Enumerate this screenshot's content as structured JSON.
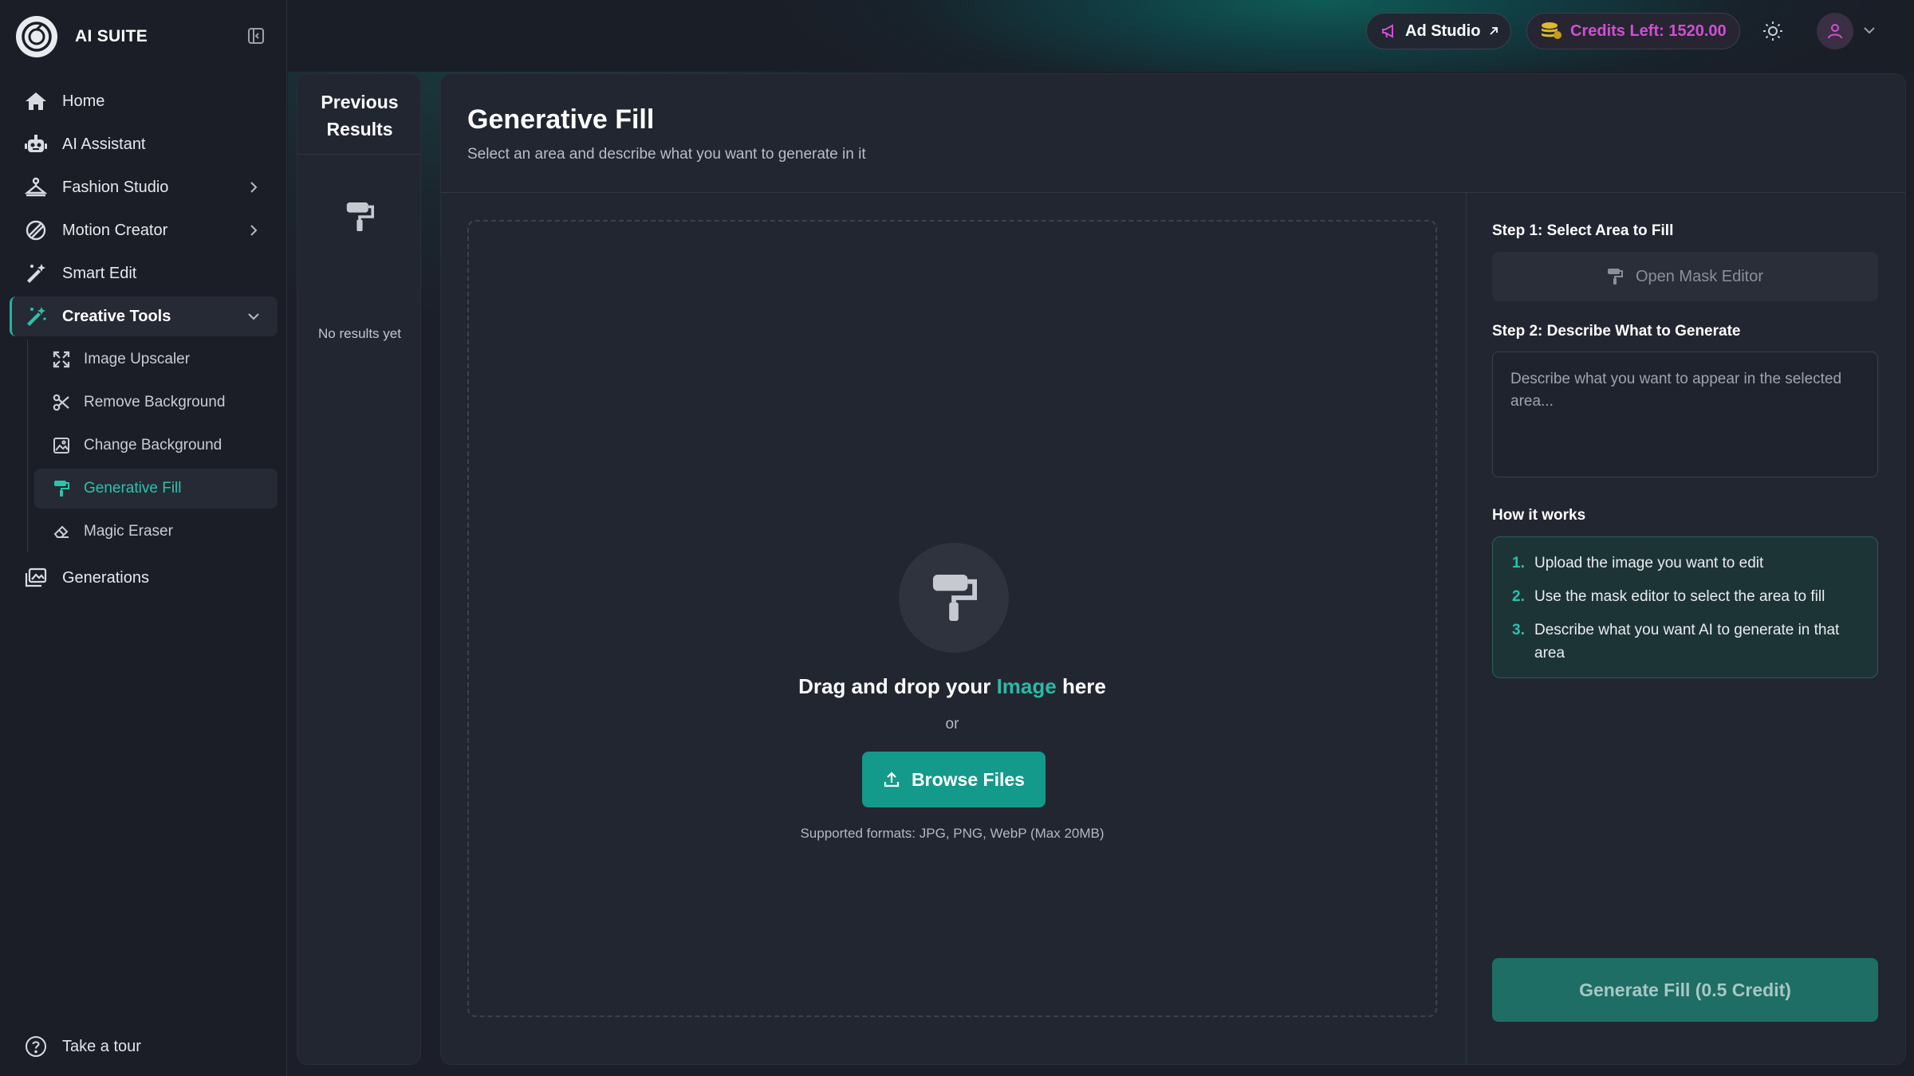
{
  "brand": {
    "name": "AI SUITE"
  },
  "nav": {
    "home": "Home",
    "ai_assistant": "AI Assistant",
    "fashion_studio": "Fashion Studio",
    "motion_creator": "Motion Creator",
    "smart_edit": "Smart Edit",
    "creative_tools": "Creative Tools",
    "generations": "Generations",
    "take_tour": "Take a tour"
  },
  "creative_tools_sub": {
    "image_upscaler": "Image Upscaler",
    "remove_background": "Remove Background",
    "change_background": "Change Background",
    "generative_fill": "Generative Fill",
    "magic_eraser": "Magic Eraser"
  },
  "header": {
    "ad_studio": "Ad Studio",
    "credits": "Credits Left: 1520.00"
  },
  "previous": {
    "title_line1": "Previous",
    "title_line2": "Results",
    "empty": "No results yet"
  },
  "main": {
    "title": "Generative Fill",
    "subtitle": "Select an area and describe what you want to generate in it"
  },
  "dropzone": {
    "text_prefix": "Drag and drop your",
    "text_accent": "Image",
    "text_suffix": "here",
    "or": "or",
    "browse": "Browse Files",
    "formats": "Supported formats: JPG, PNG, WebP (Max 20MB)"
  },
  "right": {
    "step1": "Step 1: Select Area to Fill",
    "mask_editor": "Open Mask Editor",
    "step2": "Step 2: Describe What to Generate",
    "prompt_placeholder": "Describe what you want to appear in the selected area...",
    "how_title": "How it works",
    "how_steps": [
      {
        "num": "1.",
        "text": "Upload the image you want to edit"
      },
      {
        "num": "2.",
        "text": "Use the mask editor to select the area to fill"
      },
      {
        "num": "3.",
        "text": "Describe what you want AI to generate in that area"
      }
    ],
    "generate": "Generate Fill (0.5 Credit)"
  },
  "colors": {
    "accent": "#1fb5a0",
    "credits": "#d14fd4",
    "background": "#1c1f29",
    "panel": "#222631"
  },
  "icons": {
    "home": "home-icon",
    "assistant": "robot-icon",
    "fashion": "hanger-icon",
    "motion": "motion-icon",
    "smart_edit": "magic-wand-icon",
    "creative": "sparkle-wand-icon",
    "generations": "gallery-icon",
    "tour": "help-circle-icon",
    "paint_roller": "paint-roller-icon",
    "upload": "upload-icon"
  }
}
